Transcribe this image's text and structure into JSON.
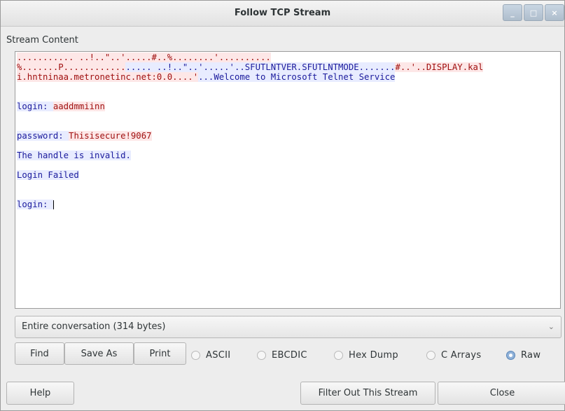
{
  "window": {
    "title": "Follow TCP Stream",
    "controls": {
      "minimize": "_",
      "maximize": "□",
      "close": "×"
    }
  },
  "stream": {
    "label": "Stream Content",
    "lines": [
      {
        "client": "",
        "server": "........... ..!..\"..'.....#..%........'.........."
      },
      {
        "client": "",
        "server": "%.......P............"
      },
      {
        "client": "..... ..!..\"..'.....'..SFUTLNTVER.SFUTLNTMODE.......",
        "server": "#..'..DISPLAY.kal"
      },
      {
        "client": "",
        "server": "i.hntninaa.metronetinc.net:0.0....'"
      },
      {
        "client": "...Welcome to Microsoft Telnet Service",
        "server": ""
      },
      {
        "client": "login: ",
        "server": "aaddmmiinn"
      },
      {
        "client": "password: ",
        "server": "Thisisecure!9067"
      },
      {
        "client": "The handle is invalid.",
        "server": ""
      },
      {
        "client": "Login Failed",
        "server": ""
      },
      {
        "client": "login: ",
        "server": ""
      }
    ]
  },
  "conversation_select": {
    "value": "Entire conversation (314 bytes)",
    "arrow_icon": "chevron-down-icon"
  },
  "buttons": {
    "find": "Find",
    "save_as": "Save As",
    "print": "Print",
    "help": "Help",
    "filter_out": "Filter Out This Stream",
    "close": "Close"
  },
  "format_options": {
    "selected": "Raw",
    "ascii": "ASCII",
    "ebcdic": "EBCDIC",
    "hex_dump": "Hex Dump",
    "c_arrays": "C Arrays",
    "raw": "Raw"
  },
  "colors": {
    "client_text": "#1a1a9c",
    "client_bg": "#e8ecff",
    "server_text": "#a01010",
    "server_bg": "#fde7e7"
  }
}
